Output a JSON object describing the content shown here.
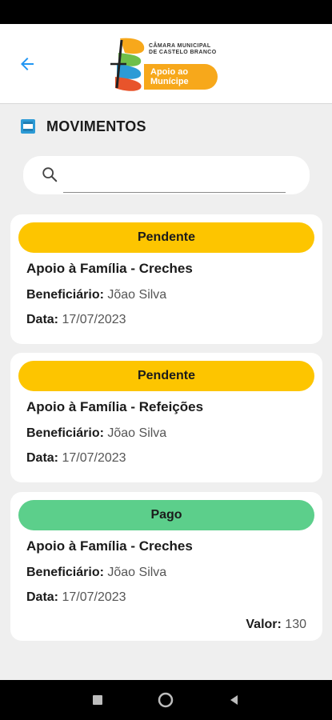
{
  "header": {
    "logo_org_line1": "CÂMARA MUNICIPAL",
    "logo_org_line2": "DE CASTELO BRANCO",
    "logo_badge_line1": "Apoio ao",
    "logo_badge_line2": "Munícipe"
  },
  "section": {
    "title": "MOVIMENTOS"
  },
  "search": {
    "value": "",
    "placeholder": ""
  },
  "labels": {
    "beneficiario": "Beneficiário:",
    "data": "Data:",
    "valor": "Valor:"
  },
  "movimentos": [
    {
      "status": "Pendente",
      "status_color": "#fdc500",
      "title": "Apoio à Família - Creches",
      "beneficiario": "Jõao Silva",
      "data": "17/07/2023"
    },
    {
      "status": "Pendente",
      "status_color": "#fdc500",
      "title": "Apoio à Família - Refeições",
      "beneficiario": "Jõao Silva",
      "data": "17/07/2023"
    },
    {
      "status": "Pago",
      "status_color": "#5ccf8b",
      "title": "Apoio à Família - Creches",
      "beneficiario": "Jõao Silva",
      "data": "17/07/2023",
      "valor": "130"
    }
  ],
  "colors": {
    "accent": "#2196f3",
    "pending": "#fdc500",
    "paid": "#5ccf8b"
  }
}
